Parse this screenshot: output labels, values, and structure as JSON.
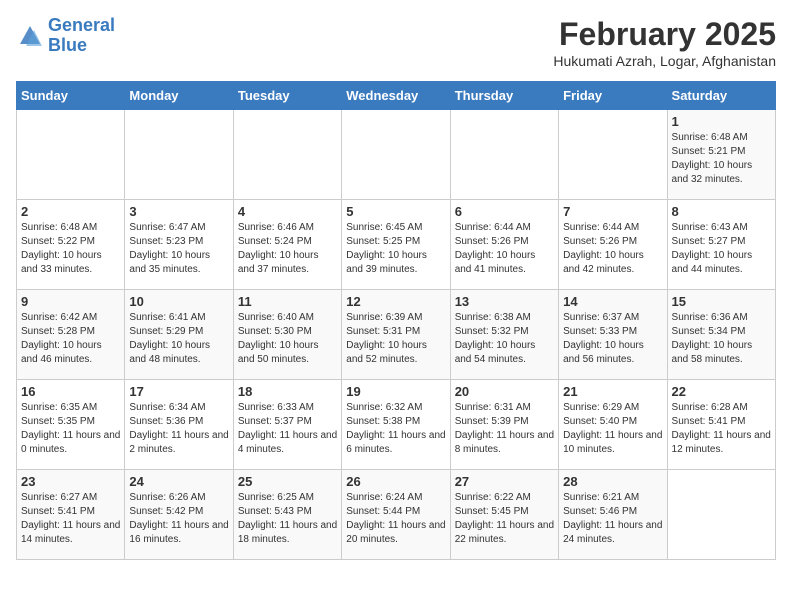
{
  "header": {
    "logo_line1": "General",
    "logo_line2": "Blue",
    "month_title": "February 2025",
    "subtitle": "Hukumati Azrah, Logar, Afghanistan"
  },
  "weekdays": [
    "Sunday",
    "Monday",
    "Tuesday",
    "Wednesday",
    "Thursday",
    "Friday",
    "Saturday"
  ],
  "weeks": [
    [
      {
        "day": "",
        "info": ""
      },
      {
        "day": "",
        "info": ""
      },
      {
        "day": "",
        "info": ""
      },
      {
        "day": "",
        "info": ""
      },
      {
        "day": "",
        "info": ""
      },
      {
        "day": "",
        "info": ""
      },
      {
        "day": "1",
        "info": "Sunrise: 6:48 AM\nSunset: 5:21 PM\nDaylight: 10 hours and 32 minutes."
      }
    ],
    [
      {
        "day": "2",
        "info": "Sunrise: 6:48 AM\nSunset: 5:22 PM\nDaylight: 10 hours and 33 minutes."
      },
      {
        "day": "3",
        "info": "Sunrise: 6:47 AM\nSunset: 5:23 PM\nDaylight: 10 hours and 35 minutes."
      },
      {
        "day": "4",
        "info": "Sunrise: 6:46 AM\nSunset: 5:24 PM\nDaylight: 10 hours and 37 minutes."
      },
      {
        "day": "5",
        "info": "Sunrise: 6:45 AM\nSunset: 5:25 PM\nDaylight: 10 hours and 39 minutes."
      },
      {
        "day": "6",
        "info": "Sunrise: 6:44 AM\nSunset: 5:26 PM\nDaylight: 10 hours and 41 minutes."
      },
      {
        "day": "7",
        "info": "Sunrise: 6:44 AM\nSunset: 5:26 PM\nDaylight: 10 hours and 42 minutes."
      },
      {
        "day": "8",
        "info": "Sunrise: 6:43 AM\nSunset: 5:27 PM\nDaylight: 10 hours and 44 minutes."
      }
    ],
    [
      {
        "day": "9",
        "info": "Sunrise: 6:42 AM\nSunset: 5:28 PM\nDaylight: 10 hours and 46 minutes."
      },
      {
        "day": "10",
        "info": "Sunrise: 6:41 AM\nSunset: 5:29 PM\nDaylight: 10 hours and 48 minutes."
      },
      {
        "day": "11",
        "info": "Sunrise: 6:40 AM\nSunset: 5:30 PM\nDaylight: 10 hours and 50 minutes."
      },
      {
        "day": "12",
        "info": "Sunrise: 6:39 AM\nSunset: 5:31 PM\nDaylight: 10 hours and 52 minutes."
      },
      {
        "day": "13",
        "info": "Sunrise: 6:38 AM\nSunset: 5:32 PM\nDaylight: 10 hours and 54 minutes."
      },
      {
        "day": "14",
        "info": "Sunrise: 6:37 AM\nSunset: 5:33 PM\nDaylight: 10 hours and 56 minutes."
      },
      {
        "day": "15",
        "info": "Sunrise: 6:36 AM\nSunset: 5:34 PM\nDaylight: 10 hours and 58 minutes."
      }
    ],
    [
      {
        "day": "16",
        "info": "Sunrise: 6:35 AM\nSunset: 5:35 PM\nDaylight: 11 hours and 0 minutes."
      },
      {
        "day": "17",
        "info": "Sunrise: 6:34 AM\nSunset: 5:36 PM\nDaylight: 11 hours and 2 minutes."
      },
      {
        "day": "18",
        "info": "Sunrise: 6:33 AM\nSunset: 5:37 PM\nDaylight: 11 hours and 4 minutes."
      },
      {
        "day": "19",
        "info": "Sunrise: 6:32 AM\nSunset: 5:38 PM\nDaylight: 11 hours and 6 minutes."
      },
      {
        "day": "20",
        "info": "Sunrise: 6:31 AM\nSunset: 5:39 PM\nDaylight: 11 hours and 8 minutes."
      },
      {
        "day": "21",
        "info": "Sunrise: 6:29 AM\nSunset: 5:40 PM\nDaylight: 11 hours and 10 minutes."
      },
      {
        "day": "22",
        "info": "Sunrise: 6:28 AM\nSunset: 5:41 PM\nDaylight: 11 hours and 12 minutes."
      }
    ],
    [
      {
        "day": "23",
        "info": "Sunrise: 6:27 AM\nSunset: 5:41 PM\nDaylight: 11 hours and 14 minutes."
      },
      {
        "day": "24",
        "info": "Sunrise: 6:26 AM\nSunset: 5:42 PM\nDaylight: 11 hours and 16 minutes."
      },
      {
        "day": "25",
        "info": "Sunrise: 6:25 AM\nSunset: 5:43 PM\nDaylight: 11 hours and 18 minutes."
      },
      {
        "day": "26",
        "info": "Sunrise: 6:24 AM\nSunset: 5:44 PM\nDaylight: 11 hours and 20 minutes."
      },
      {
        "day": "27",
        "info": "Sunrise: 6:22 AM\nSunset: 5:45 PM\nDaylight: 11 hours and 22 minutes."
      },
      {
        "day": "28",
        "info": "Sunrise: 6:21 AM\nSunset: 5:46 PM\nDaylight: 11 hours and 24 minutes."
      },
      {
        "day": "",
        "info": ""
      }
    ]
  ]
}
